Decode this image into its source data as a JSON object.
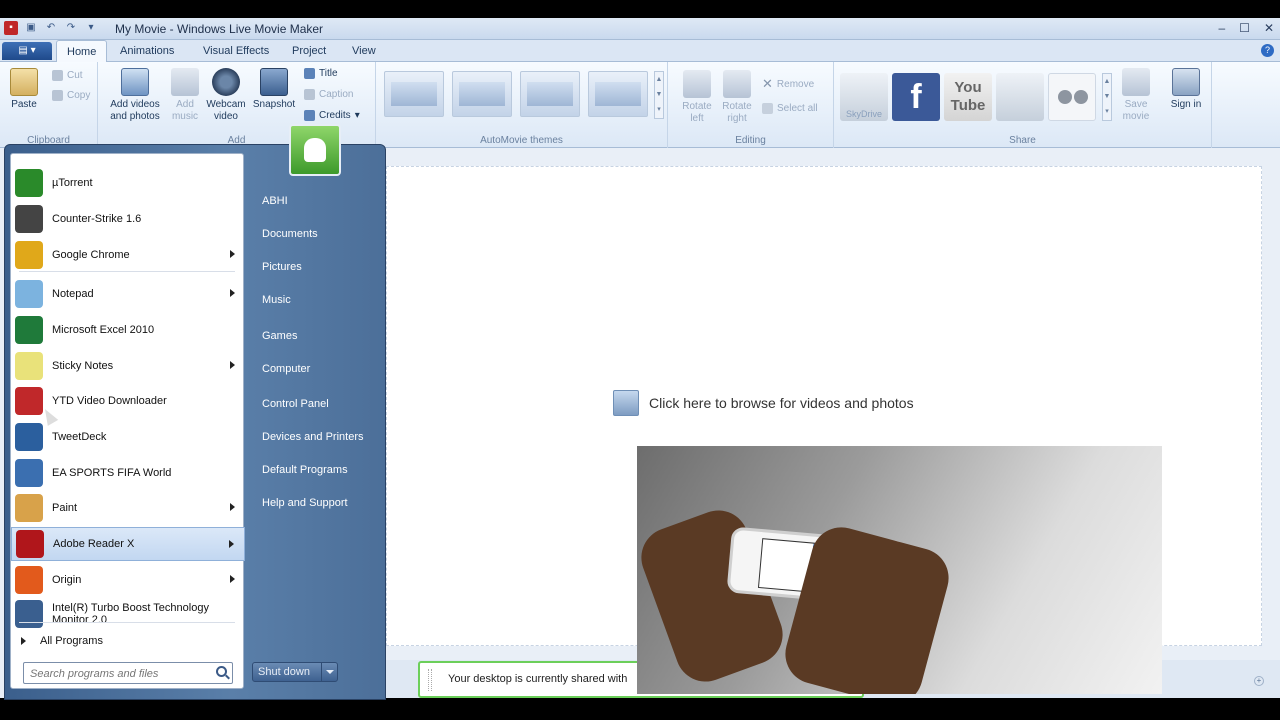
{
  "window": {
    "title": "My Movie - Windows Live Movie Maker",
    "controls": [
      "–",
      "☐",
      "✕"
    ]
  },
  "ribbon": {
    "tabs": [
      "Home",
      "Animations",
      "Visual Effects",
      "Project",
      "View"
    ],
    "clipboard": {
      "paste": "Paste",
      "cut": "Cut",
      "copy": "Copy",
      "label": "Clipboard"
    },
    "add": {
      "add_videos": "Add videos and photos",
      "add_music": "Add music",
      "webcam": "Webcam video",
      "snapshot": "Snapshot",
      "title": "Title",
      "caption": "Caption",
      "credits": "Credits",
      "label": "Add"
    },
    "themes_label": "AutoMovie themes",
    "editing": {
      "rotate_left": "Rotate left",
      "rotate_right": "Rotate right",
      "remove": "Remove",
      "select_all": "Select all",
      "label": "Editing"
    },
    "share": {
      "skydrive": "SkyDrive",
      "facebook": "f",
      "youtube": "You Tube",
      "save_movie": "Save movie",
      "sign_in": "Sign in",
      "label": "Share"
    }
  },
  "storyboard": {
    "hint": "Click here to browse for videos and photos"
  },
  "share_notice": "Your desktop is currently shared with",
  "start_menu": {
    "programs": [
      {
        "label": "µTorrent",
        "arrow": false,
        "color": "#2a8a2a"
      },
      {
        "label": "Counter-Strike 1.6",
        "arrow": false,
        "color": "#444444"
      },
      {
        "label": "Google Chrome",
        "arrow": true,
        "color": "#e0a81a"
      },
      {
        "label": "Notepad",
        "arrow": true,
        "color": "#7cb3df"
      },
      {
        "label": "Microsoft Excel 2010",
        "arrow": false,
        "color": "#1f7a3a"
      },
      {
        "label": "Sticky Notes",
        "arrow": true,
        "color": "#e9e27a"
      },
      {
        "label": "YTD Video Downloader",
        "arrow": false,
        "color": "#c0282a"
      },
      {
        "label": "TweetDeck",
        "arrow": false,
        "color": "#2b5f9e"
      },
      {
        "label": "EA SPORTS FIFA World",
        "arrow": false,
        "color": "#3b6fb0"
      },
      {
        "label": "Paint",
        "arrow": true,
        "color": "#d8a24a"
      },
      {
        "label": "Adobe Reader X",
        "arrow": true,
        "color": "#b0161b"
      },
      {
        "label": "Origin",
        "arrow": true,
        "color": "#e25a1c"
      },
      {
        "label": "Intel(R) Turbo Boost Technology Monitor 2.0",
        "arrow": false,
        "color": "#3a5f8f"
      }
    ],
    "all_programs": "All Programs",
    "search_placeholder": "Search programs and files",
    "right_links": [
      "ABHI",
      "Documents",
      "Pictures",
      "Music",
      "Games",
      "Computer",
      "Control Panel",
      "Devices and Printers",
      "Default Programs",
      "Help and Support"
    ],
    "shutdown": "Shut down"
  }
}
